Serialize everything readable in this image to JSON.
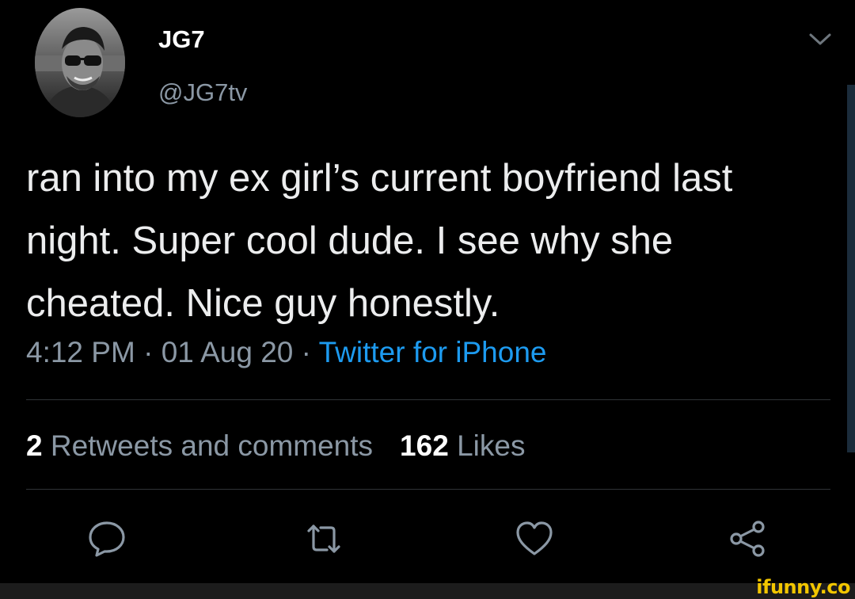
{
  "tweet": {
    "author_name": "JG7",
    "author_handle": "@JG7tv",
    "text": "ran into my ex girl’s current boyfriend last night. Super cool dude. I see why she cheated. Nice guy honestly.",
    "time": "4:12 PM",
    "separator": " · ",
    "date": "01 Aug 20",
    "source": "Twitter for iPhone",
    "retweets_count": "2",
    "retweets_label": "Retweets and comments",
    "likes_count": "162",
    "likes_label": "Likes"
  },
  "actions": [
    {
      "name": "reply",
      "icon": "speech-bubble-icon"
    },
    {
      "name": "retweet",
      "icon": "retweet-icon"
    },
    {
      "name": "like",
      "icon": "heart-icon"
    },
    {
      "name": "share",
      "icon": "share-icon"
    }
  ],
  "colors": {
    "background": "#000000",
    "text": "#ecedee",
    "secondary": "#8b98a5",
    "link": "#1d9bf0",
    "watermark": "#f2c600"
  },
  "watermark": "ifunny.co"
}
